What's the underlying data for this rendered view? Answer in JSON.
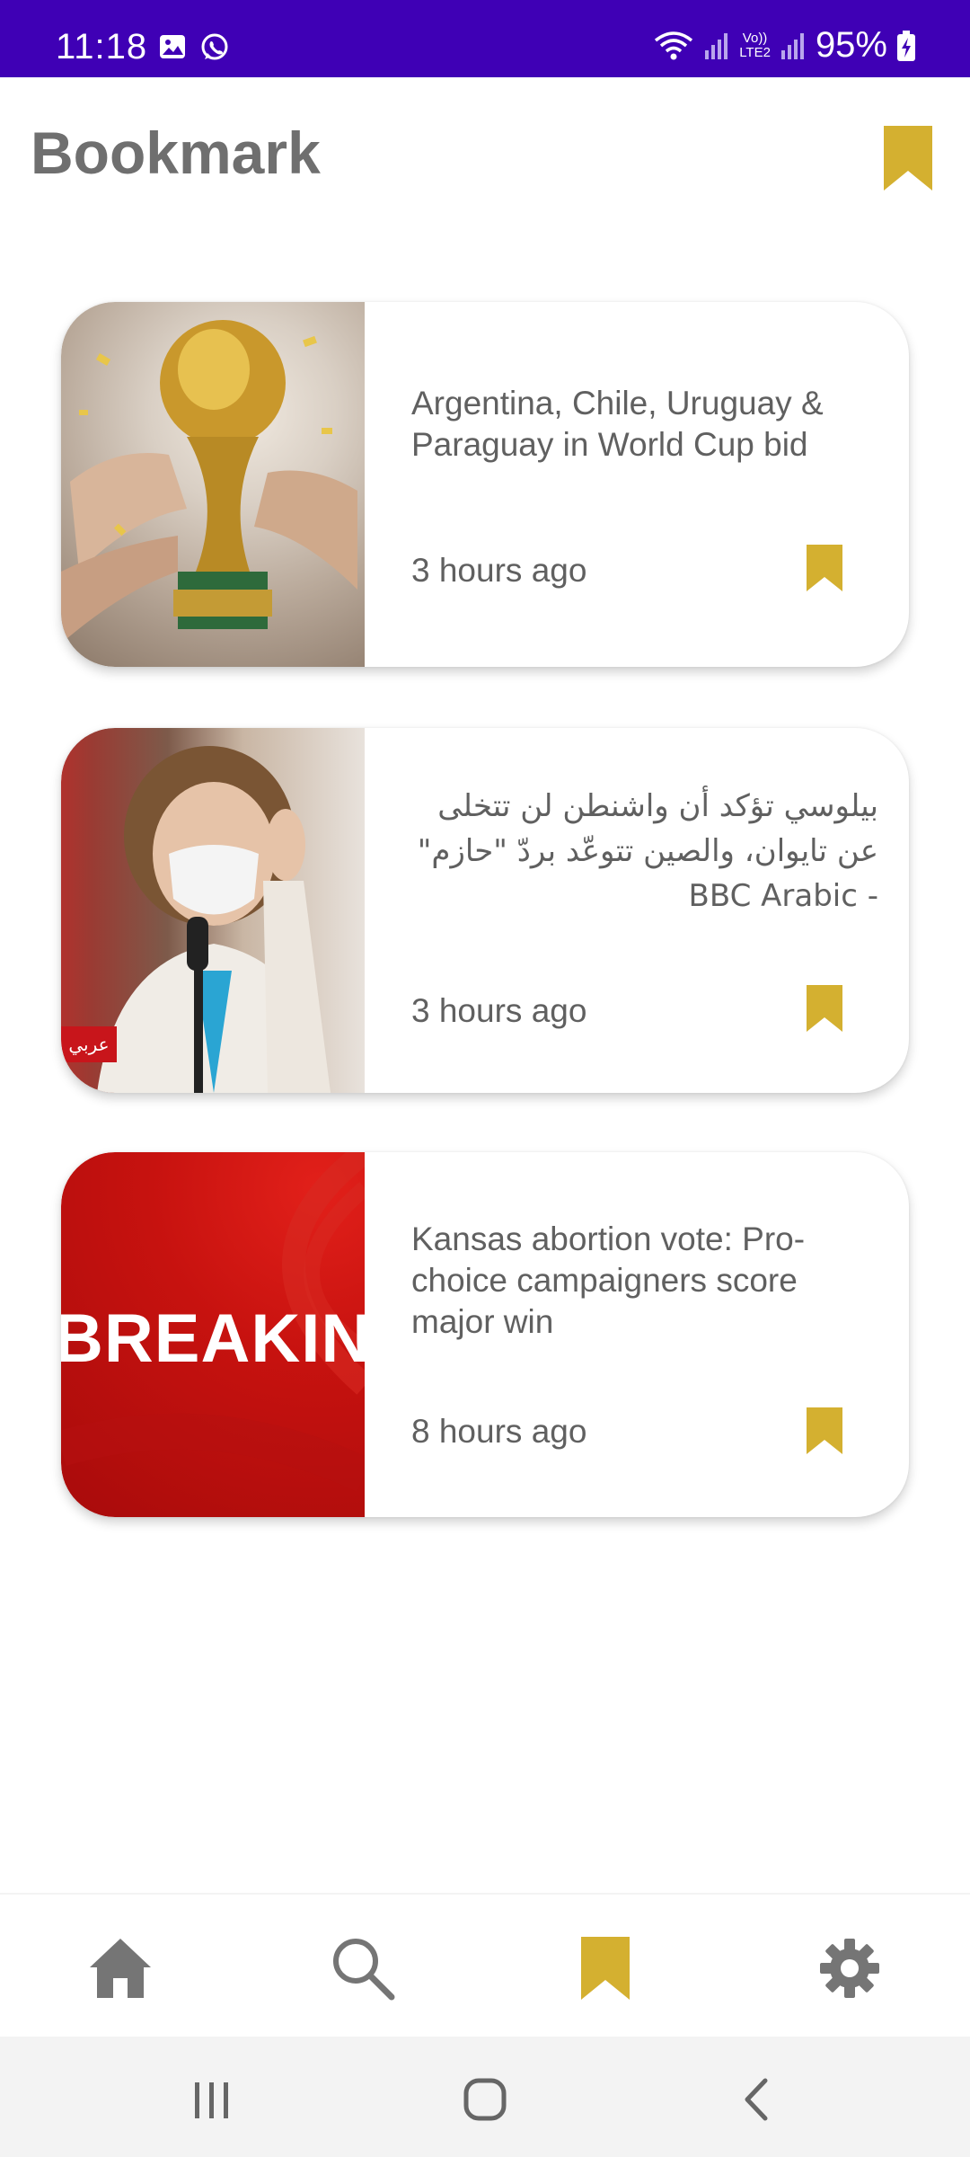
{
  "status_bar": {
    "time": "11:18",
    "network": "LTE2",
    "battery": "95%",
    "icons": [
      "image-icon",
      "whatsapp-icon",
      "wifi-icon",
      "signal-icon",
      "lte-icon",
      "signal-icon",
      "battery-charging-icon"
    ]
  },
  "header": {
    "title": "Bookmark",
    "bookmark_icon": "bookmark-icon"
  },
  "colors": {
    "status_bar": "#3f00b5",
    "accent_gold": "#d4b030",
    "text_gray": "#606060",
    "nav_gray": "#757575"
  },
  "articles": [
    {
      "title": "Argentina, Chile, Uruguay & Paraguay in World Cup bid",
      "time": "3 hours ago",
      "image": "world-cup-trophy"
    },
    {
      "title": "بيلوسي تؤكد أن واشنطن لن تتخلى عن تايوان، والصين تتوعّد بردّ \"حازم\" - BBC Arabic",
      "time": "3 hours ago",
      "image": "pelosi-press",
      "image_tag": "عربي"
    },
    {
      "title": "Kansas abortion vote: Pro-choice campaigners score major win",
      "time": "8 hours ago",
      "image": "breaking-news",
      "image_text": "BREAKING"
    }
  ],
  "bottom_nav": {
    "items": [
      {
        "name": "home",
        "icon": "home-icon",
        "active": false
      },
      {
        "name": "search",
        "icon": "search-icon",
        "active": false
      },
      {
        "name": "bookmark",
        "icon": "bookmark-icon",
        "active": true
      },
      {
        "name": "settings",
        "icon": "gear-icon",
        "active": false
      }
    ]
  },
  "system_nav": {
    "items": [
      "recents-icon",
      "home-circle-icon",
      "back-icon"
    ]
  }
}
